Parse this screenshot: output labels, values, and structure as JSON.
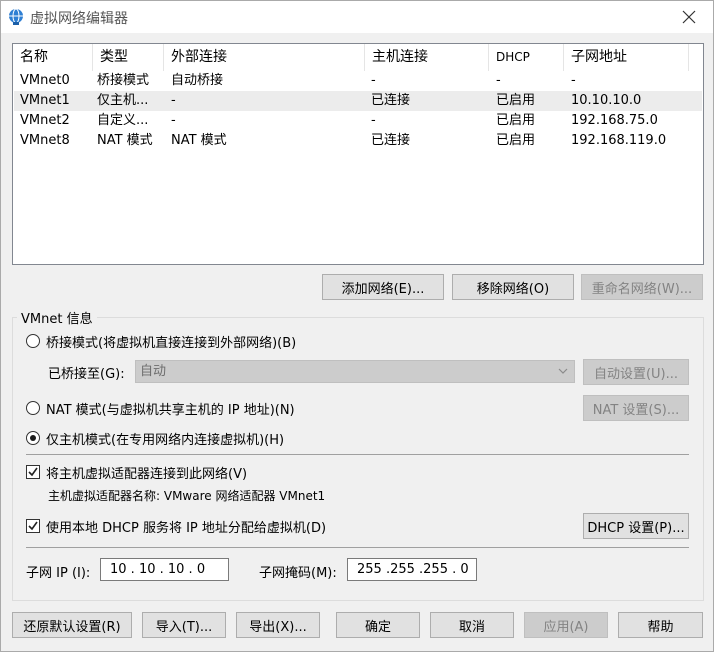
{
  "window": {
    "title": "虚拟网络编辑器"
  },
  "table": {
    "headers": [
      "名称",
      "类型",
      "外部连接",
      "主机连接",
      "DHCP",
      "子网地址"
    ],
    "rows": [
      [
        "VMnet0",
        "桥接模式",
        "自动桥接",
        "-",
        "-",
        "-"
      ],
      [
        "VMnet1",
        "仅主机...",
        "-",
        "已连接",
        "已启用",
        "10.10.10.0"
      ],
      [
        "VMnet2",
        "自定义...",
        "-",
        "-",
        "已启用",
        "192.168.75.0"
      ],
      [
        "VMnet8",
        "NAT 模式",
        "NAT 模式",
        "已连接",
        "已启用",
        "192.168.119.0"
      ]
    ]
  },
  "net_buttons": {
    "add": "添加网络(E)...",
    "remove": "移除网络(O)",
    "rename": "重命名网络(W)..."
  },
  "vmnet_info": {
    "legend": "VMnet 信息",
    "bridge_label": "桥接模式(将虚拟机直接连接到外部网络)(B)",
    "bridged_to_label": "已桥接至(G):",
    "bridged_to_value": "自动",
    "auto_settings": "自动设置(U)...",
    "nat_label": "NAT 模式(与虚拟机共享主机的 IP 地址)(N)",
    "nat_settings": "NAT 设置(S)...",
    "host_only_label": "仅主机模式(在专用网络内连接虚拟机)(H)",
    "connect_adapter_label": "将主机虚拟适配器连接到此网络(V)",
    "adapter_name_text": "主机虚拟适配器名称: VMware 网络适配器 VMnet1",
    "dhcp_label": "使用本地 DHCP 服务将 IP 地址分配给虚拟机(D)",
    "dhcp_settings": "DHCP 设置(P)...",
    "subnet_ip_label": "子网 IP (I):",
    "subnet_ip_value": "10 . 10 . 10 . 0",
    "subnet_mask_label": "子网掩码(M):",
    "subnet_mask_value": "255 .255 .255 . 0"
  },
  "footer": {
    "restore": "还原默认设置(R)",
    "import": "导入(T)...",
    "export": "导出(X)...",
    "ok": "确定",
    "cancel": "取消",
    "apply": "应用(A)",
    "help": "帮助"
  }
}
